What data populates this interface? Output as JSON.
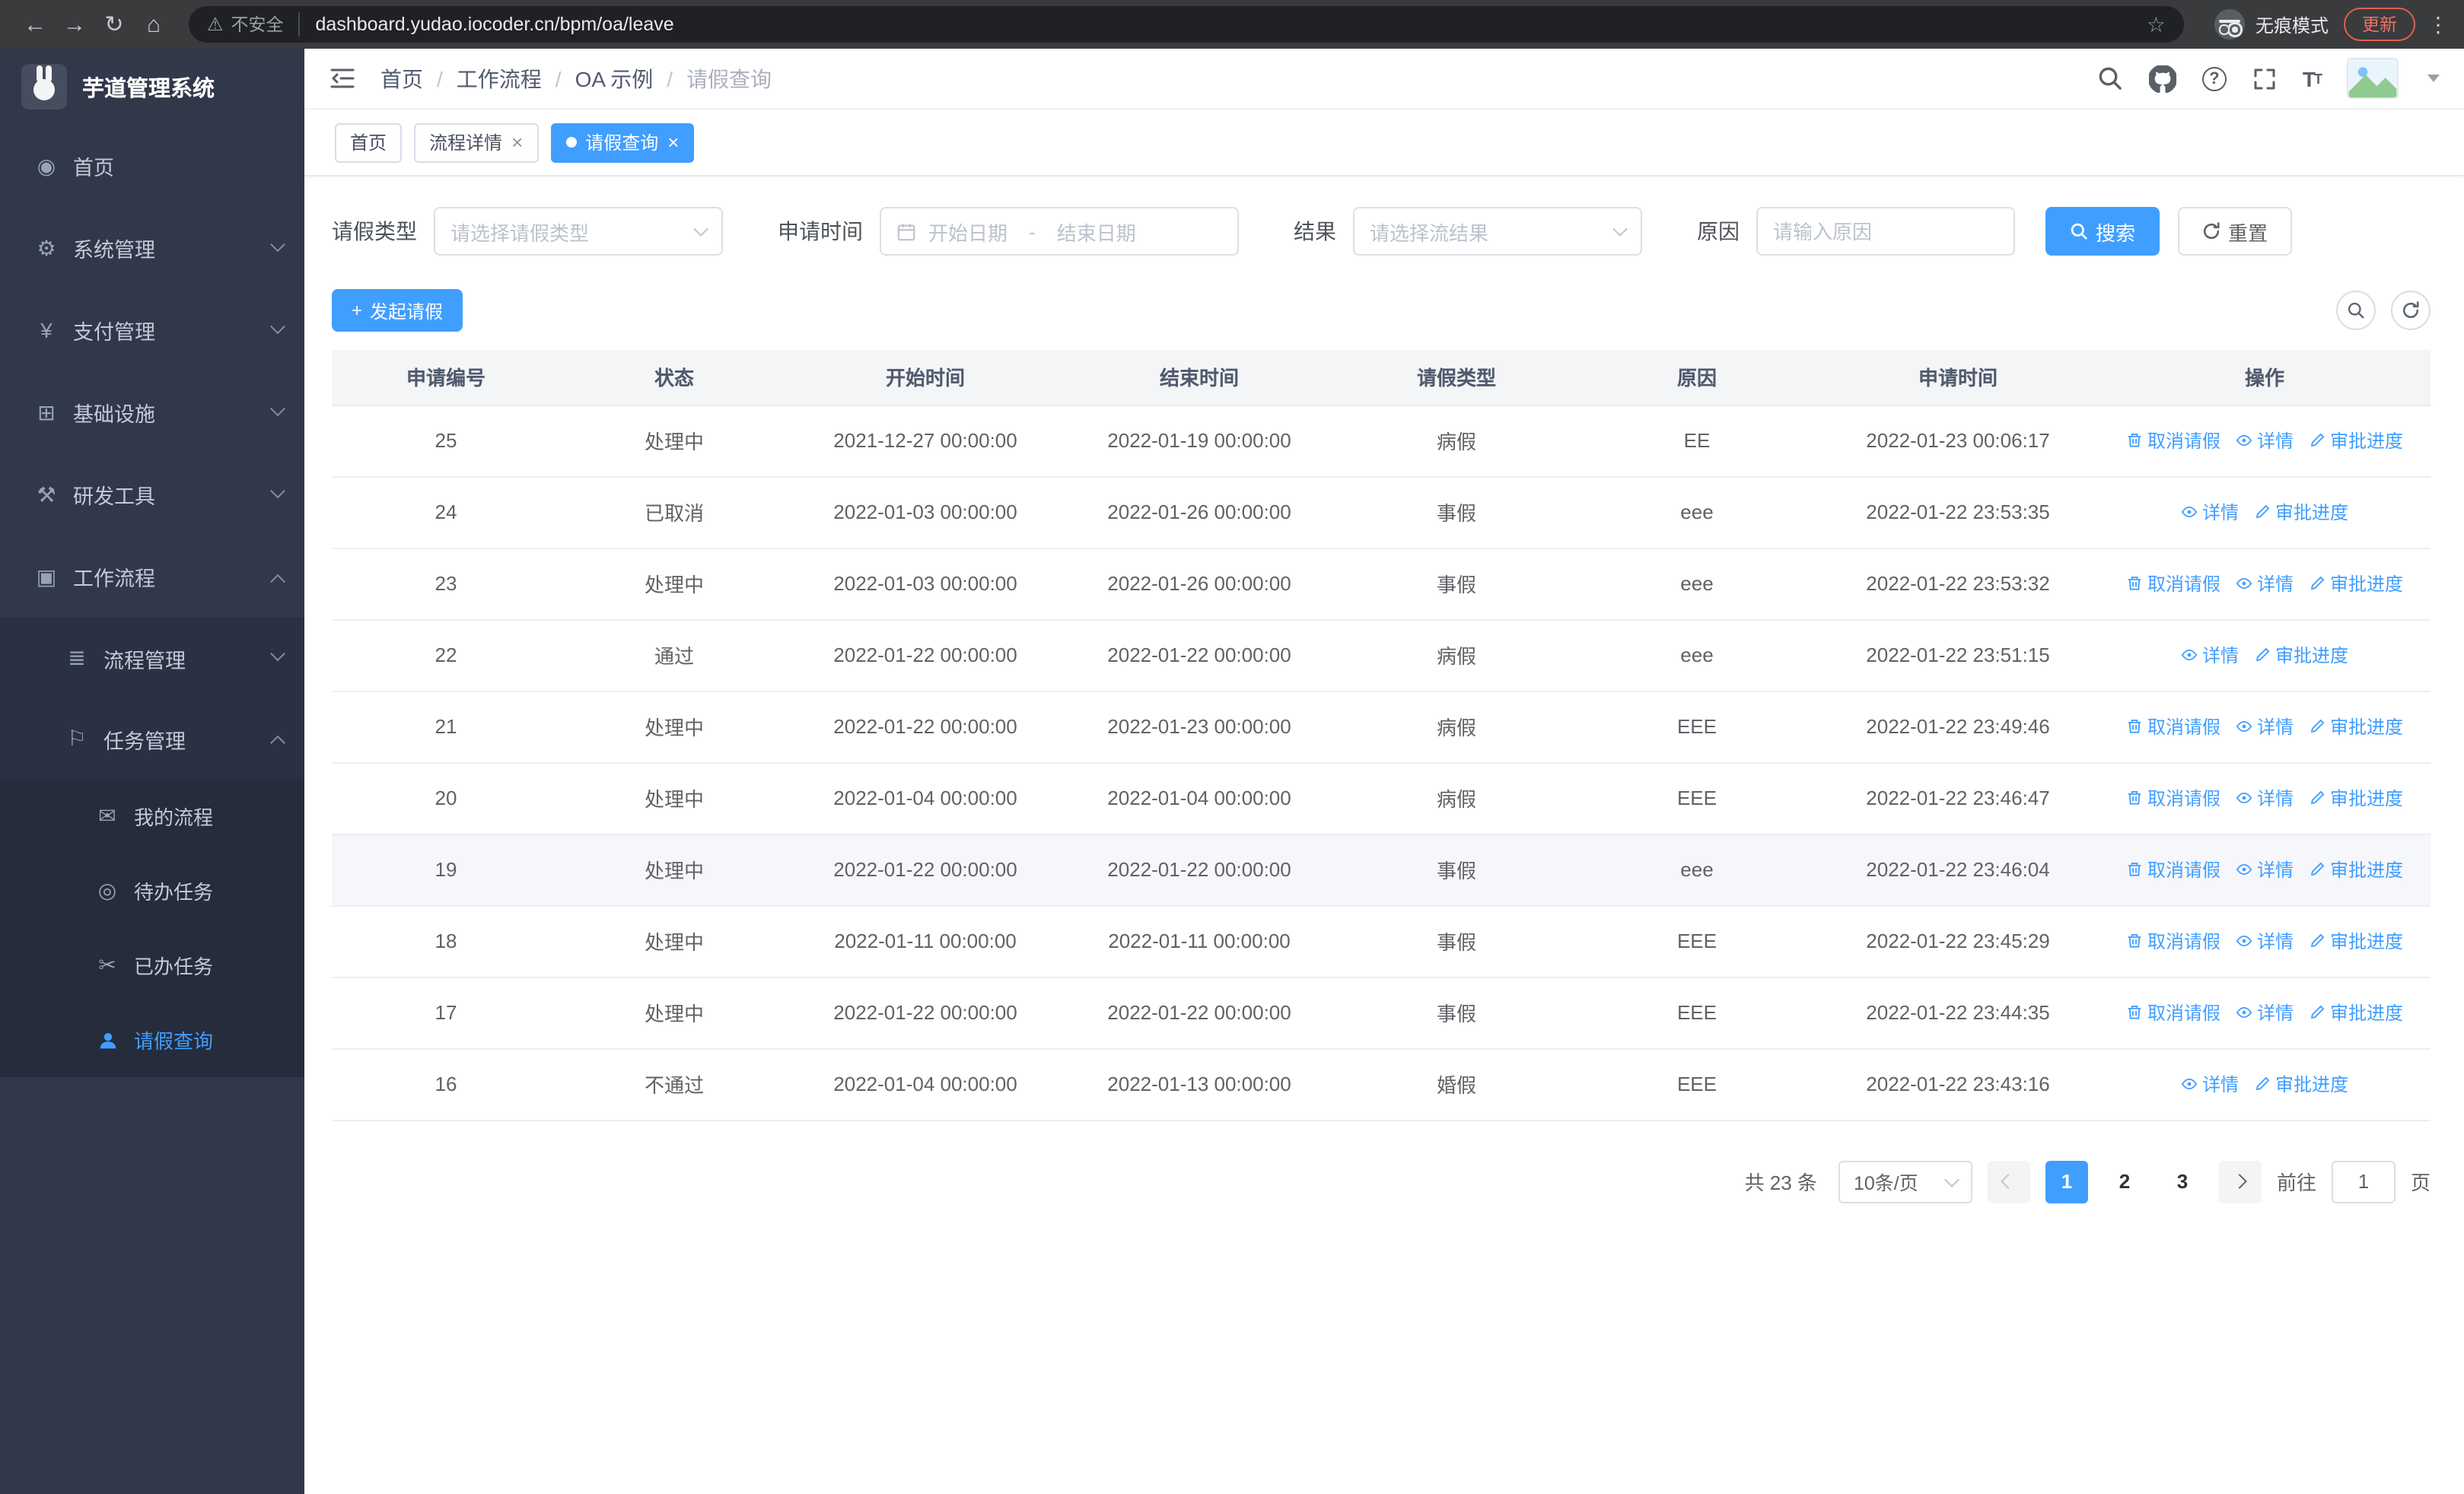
{
  "browser": {
    "security_label": "不安全",
    "url": "dashboard.yudao.iocoder.cn/bpm/oa/leave",
    "incognito_label": "无痕模式",
    "update_label": "更新"
  },
  "sidebar": {
    "logo_title": "芋道管理系统",
    "items": [
      {
        "name": "home",
        "label": "首页",
        "icon": "dashboard-icon",
        "level": 1,
        "chevron": null,
        "active": false
      },
      {
        "name": "system",
        "label": "系统管理",
        "icon": "gear-icon",
        "level": 1,
        "chevron": "down",
        "active": false
      },
      {
        "name": "payment",
        "label": "支付管理",
        "icon": "yen-icon",
        "level": 1,
        "chevron": "down",
        "active": false
      },
      {
        "name": "infrastructure",
        "label": "基础设施",
        "icon": "infra-icon",
        "level": 1,
        "chevron": "down",
        "active": false
      },
      {
        "name": "devtools",
        "label": "研发工具",
        "icon": "tools-icon",
        "level": 1,
        "chevron": "down",
        "active": false
      },
      {
        "name": "workflow",
        "label": "工作流程",
        "icon": "workflow-icon",
        "level": 1,
        "chevron": "up",
        "active": false
      },
      {
        "name": "process-mgmt",
        "label": "流程管理",
        "icon": "process-icon",
        "level": 2,
        "chevron": "down",
        "active": false
      },
      {
        "name": "task-mgmt",
        "label": "任务管理",
        "icon": "task-icon",
        "level": 2,
        "chevron": "up",
        "active": false
      },
      {
        "name": "my-process",
        "label": "我的流程",
        "icon": "chat-icon",
        "level": 3,
        "chevron": null,
        "active": false
      },
      {
        "name": "todo-tasks",
        "label": "待办任务",
        "icon": "eye-icon",
        "level": 3,
        "chevron": null,
        "active": false
      },
      {
        "name": "done-tasks",
        "label": "已办任务",
        "icon": "scissors-icon",
        "level": 3,
        "chevron": null,
        "active": false
      },
      {
        "name": "leave-query",
        "label": "请假查询",
        "icon": "user-icon",
        "level": 3,
        "chevron": null,
        "active": true
      }
    ]
  },
  "header": {
    "breadcrumb": [
      "首页",
      "工作流程",
      "OA 示例",
      "请假查询"
    ],
    "breadcrumb_separator": "/"
  },
  "tabs": [
    {
      "label": "首页",
      "active": false,
      "closable": false
    },
    {
      "label": "流程详情",
      "active": false,
      "closable": true
    },
    {
      "label": "请假查询",
      "active": true,
      "closable": true
    }
  ],
  "filters": {
    "leave_type_label": "请假类型",
    "leave_type_placeholder": "请选择请假类型",
    "apply_time_label": "申请时间",
    "start_date_placeholder": "开始日期",
    "range_separator": "-",
    "end_date_placeholder": "结束日期",
    "result_label": "结果",
    "result_placeholder": "请选择流结果",
    "reason_label": "原因",
    "reason_placeholder": "请输入原因",
    "search_label": "搜索",
    "reset_label": "重置"
  },
  "toolbar": {
    "create_label": "发起请假"
  },
  "table": {
    "columns": [
      "申请编号",
      "状态",
      "开始时间",
      "结束时间",
      "请假类型",
      "原因",
      "申请时间",
      "操作"
    ],
    "action_labels": {
      "cancel": "取消请假",
      "detail": "详情",
      "progress": "审批进度"
    },
    "rows": [
      {
        "id": "25",
        "status": "处理中",
        "start": "2021-12-27 00:00:00",
        "end": "2022-01-19 00:00:00",
        "type": "病假",
        "reason": "EE",
        "applied": "2022-01-23 00:06:17",
        "actions": [
          "cancel",
          "detail",
          "progress"
        ]
      },
      {
        "id": "24",
        "status": "已取消",
        "start": "2022-01-03 00:00:00",
        "end": "2022-01-26 00:00:00",
        "type": "事假",
        "reason": "eee",
        "applied": "2022-01-22 23:53:35",
        "actions": [
          "detail",
          "progress"
        ]
      },
      {
        "id": "23",
        "status": "处理中",
        "start": "2022-01-03 00:00:00",
        "end": "2022-01-26 00:00:00",
        "type": "事假",
        "reason": "eee",
        "applied": "2022-01-22 23:53:32",
        "actions": [
          "cancel",
          "detail",
          "progress"
        ]
      },
      {
        "id": "22",
        "status": "通过",
        "start": "2022-01-22 00:00:00",
        "end": "2022-01-22 00:00:00",
        "type": "病假",
        "reason": "eee",
        "applied": "2022-01-22 23:51:15",
        "actions": [
          "detail",
          "progress"
        ]
      },
      {
        "id": "21",
        "status": "处理中",
        "start": "2022-01-22 00:00:00",
        "end": "2022-01-23 00:00:00",
        "type": "病假",
        "reason": "EEE",
        "applied": "2022-01-22 23:49:46",
        "actions": [
          "cancel",
          "detail",
          "progress"
        ]
      },
      {
        "id": "20",
        "status": "处理中",
        "start": "2022-01-04 00:00:00",
        "end": "2022-01-04 00:00:00",
        "type": "病假",
        "reason": "EEE",
        "applied": "2022-01-22 23:46:47",
        "actions": [
          "cancel",
          "detail",
          "progress"
        ]
      },
      {
        "id": "19",
        "status": "处理中",
        "start": "2022-01-22 00:00:00",
        "end": "2022-01-22 00:00:00",
        "type": "事假",
        "reason": "eee",
        "applied": "2022-01-22 23:46:04",
        "actions": [
          "cancel",
          "detail",
          "progress"
        ]
      },
      {
        "id": "18",
        "status": "处理中",
        "start": "2022-01-11 00:00:00",
        "end": "2022-01-11 00:00:00",
        "type": "事假",
        "reason": "EEE",
        "applied": "2022-01-22 23:45:29",
        "actions": [
          "cancel",
          "detail",
          "progress"
        ]
      },
      {
        "id": "17",
        "status": "处理中",
        "start": "2022-01-22 00:00:00",
        "end": "2022-01-22 00:00:00",
        "type": "事假",
        "reason": "EEE",
        "applied": "2022-01-22 23:44:35",
        "actions": [
          "cancel",
          "detail",
          "progress"
        ]
      },
      {
        "id": "16",
        "status": "不通过",
        "start": "2022-01-04 00:00:00",
        "end": "2022-01-13 00:00:00",
        "type": "婚假",
        "reason": "EEE",
        "applied": "2022-01-22 23:43:16",
        "actions": [
          "detail",
          "progress"
        ]
      }
    ]
  },
  "pagination": {
    "total_label": "共 23 条",
    "page_size": "10条/页",
    "pages": [
      "1",
      "2",
      "3"
    ],
    "active_page": "1",
    "goto_prefix": "前往",
    "goto_value": "1",
    "goto_suffix": "页"
  },
  "colors": {
    "accent": "#409eff",
    "sidebar_bg": "#30384a",
    "update_badge": "#e0604e"
  }
}
